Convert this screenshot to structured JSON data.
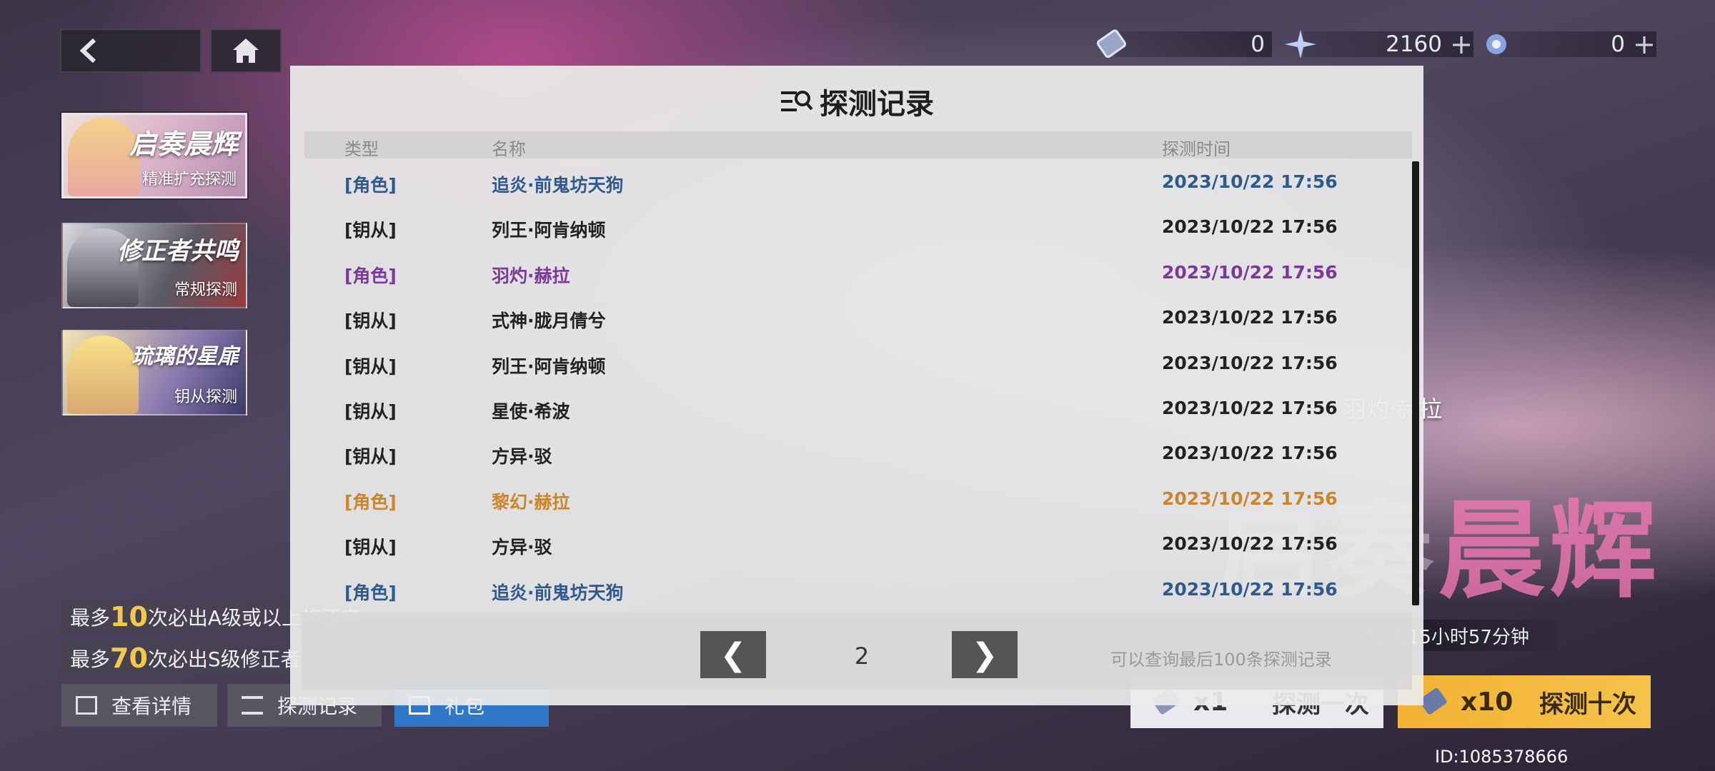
{
  "top_bar": {
    "resources": [
      {
        "icon": "ticket-icon",
        "value": "0"
      },
      {
        "icon": "crystal-icon",
        "value": "2160"
      },
      {
        "icon": "starlight-icon",
        "value": "0"
      }
    ]
  },
  "banners": [
    {
      "title": "启奏晨辉",
      "subtitle": "精准扩充探测"
    },
    {
      "title": "修正者共鸣",
      "subtitle": "常规探测"
    },
    {
      "title": "琉璃的星扉",
      "subtitle": "钥从探测"
    }
  ],
  "info": {
    "line1_prefix": "最多",
    "line1_num": "10",
    "line1_suffix": "次必出A级或以上修正者",
    "line2_prefix": "最多",
    "line2_num": "70",
    "line2_suffix": "次必出S级修正者"
  },
  "bottom_left_buttons": {
    "details": "查看详情",
    "records": "探测记录",
    "gift": "礼包"
  },
  "right_panel": {
    "char_name": "羽灼·赫拉",
    "countdown": "12天15小时57分钟",
    "pull_one_count": "x1",
    "pull_one_label": "探测一次",
    "pull_ten_count": "x10",
    "pull_ten_label": "探测十次",
    "uid": "ID:1085378666"
  },
  "dialog": {
    "title": "探测记录",
    "headers": {
      "type": "类型",
      "name": "名称",
      "time": "探测时间"
    },
    "colors": {
      "blue": "#2f5a8e",
      "purple": "#7a3a9a",
      "gold": "#c9862a",
      "default": "#222222"
    },
    "rows": [
      {
        "type": "[角色]",
        "name": "追炎·前鬼坊天狗",
        "time": "2023/10/22 17:56",
        "color": "#2f5a8e"
      },
      {
        "type": "[钥从]",
        "name": "列王·阿肯纳顿",
        "time": "2023/10/22 17:56",
        "color": "#222222"
      },
      {
        "type": "[角色]",
        "name": "羽灼·赫拉",
        "time": "2023/10/22 17:56",
        "color": "#7a3a9a"
      },
      {
        "type": "[钥从]",
        "name": "式神·胧月倩兮",
        "time": "2023/10/22 17:56",
        "color": "#222222"
      },
      {
        "type": "[钥从]",
        "name": "列王·阿肯纳顿",
        "time": "2023/10/22 17:56",
        "color": "#222222"
      },
      {
        "type": "[钥从]",
        "name": "星使·希波",
        "time": "2023/10/22 17:56",
        "color": "#222222"
      },
      {
        "type": "[钥从]",
        "name": "方异·驳",
        "time": "2023/10/22 17:56",
        "color": "#222222"
      },
      {
        "type": "[角色]",
        "name": "黎幻·赫拉",
        "time": "2023/10/22 17:56",
        "color": "#c9862a"
      },
      {
        "type": "[钥从]",
        "name": "方异·驳",
        "time": "2023/10/22 17:56",
        "color": "#222222"
      },
      {
        "type": "[角色]",
        "name": "追炎·前鬼坊天狗",
        "time": "2023/10/22 17:56",
        "color": "#2f5a8e"
      }
    ],
    "page": "2",
    "prev_label": "❮",
    "next_label": "❯",
    "hint": "可以查询最后100条探测记录"
  }
}
